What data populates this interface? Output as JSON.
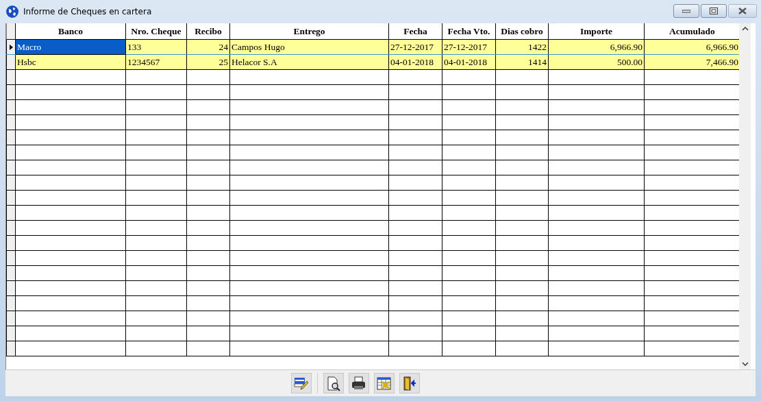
{
  "window": {
    "title": "Informe de Cheques en cartera"
  },
  "table": {
    "columns": [
      {
        "label": "Banco"
      },
      {
        "label": "Nro. Cheque"
      },
      {
        "label": "Recibo"
      },
      {
        "label": "Entrego"
      },
      {
        "label": "Fecha"
      },
      {
        "label": "Fecha Vto."
      },
      {
        "label": "Dias cobro"
      },
      {
        "label": "Importe"
      },
      {
        "label": "Acumulado"
      }
    ],
    "rows": [
      {
        "selected": true,
        "cells": [
          "Macro",
          "133",
          "24",
          "Campos Hugo",
          "27-12-2017",
          "27-12-2017",
          "1422",
          "6,966.90",
          "6,966.90"
        ]
      },
      {
        "selected": false,
        "cells": [
          "Hsbc",
          "1234567",
          "25",
          "Helacor S.A",
          "04-01-2018",
          "04-01-2018",
          "1414",
          "500.00",
          "7,466.90"
        ]
      }
    ]
  },
  "toolbar": [
    {
      "kind": "edit"
    },
    {
      "kind": "preview"
    },
    {
      "kind": "print"
    },
    {
      "kind": "export"
    },
    {
      "kind": "exit"
    }
  ]
}
